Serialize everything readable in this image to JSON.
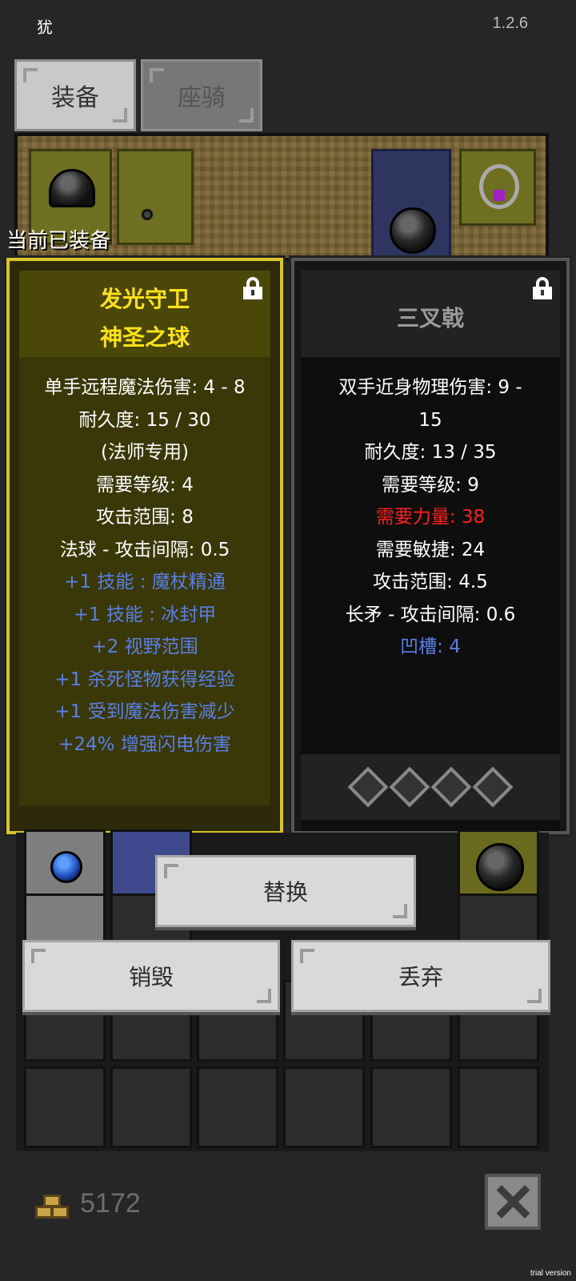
{
  "header": {
    "left_text": "犹",
    "version": "1.2.6"
  },
  "tabs": [
    {
      "label": "装备",
      "active": true
    },
    {
      "label": "座骑",
      "active": false
    }
  ],
  "currently_equipped_label": "当前已装备",
  "left_item": {
    "title1": "发光守卫",
    "title2": "神圣之球",
    "title_color": "#ffe21a",
    "locked": true,
    "stats": [
      {
        "text": "单手远程魔法伤害: 4 - 8",
        "style": "white"
      },
      {
        "text": "耐久度: 15 / 30",
        "style": "white"
      },
      {
        "text": "(法师专用)",
        "style": "white"
      },
      {
        "text": "需要等级: 4",
        "style": "white"
      },
      {
        "text": "攻击范围: 8",
        "style": "white"
      },
      {
        "text": "法球 - 攻击间隔: 0.5",
        "style": "white"
      },
      {
        "text": "+1 技能 : 魔杖精通",
        "style": "blue"
      },
      {
        "text": "+1 技能 : 冰封甲",
        "style": "blue"
      },
      {
        "text": "+2 视野范围",
        "style": "blue"
      },
      {
        "text": "+1 杀死怪物获得经验",
        "style": "blue"
      },
      {
        "text": "+1 受到魔法伤害减少",
        "style": "blue"
      },
      {
        "text": "+24% 增强闪电伤害",
        "style": "blue"
      }
    ]
  },
  "right_item": {
    "title": "三叉戟",
    "title_color": "#9a9a9a",
    "locked": true,
    "stats": [
      {
        "text": "双手近身物理伤害: 9 -",
        "style": "white"
      },
      {
        "text": "15",
        "style": "white"
      },
      {
        "text": "耐久度: 13 / 35",
        "style": "white"
      },
      {
        "text": "需要等级: 9",
        "style": "white"
      },
      {
        "text": "需要力量: 38",
        "style": "red"
      },
      {
        "text": "需要敏捷: 24",
        "style": "white"
      },
      {
        "text": "攻击范围: 4.5",
        "style": "white"
      },
      {
        "text": "长矛 - 攻击间隔: 0.6",
        "style": "white"
      },
      {
        "text": "凹槽: 4",
        "style": "blue"
      }
    ],
    "sockets": 4
  },
  "buttons": {
    "replace": "替换",
    "destroy": "销毁",
    "discard": "丢弃"
  },
  "gold": "5172",
  "watermark": "trial version",
  "colors": {
    "stat_blue": "#5b7fe6",
    "stat_red": "#ff2020",
    "left_border": "#d9c52a"
  }
}
